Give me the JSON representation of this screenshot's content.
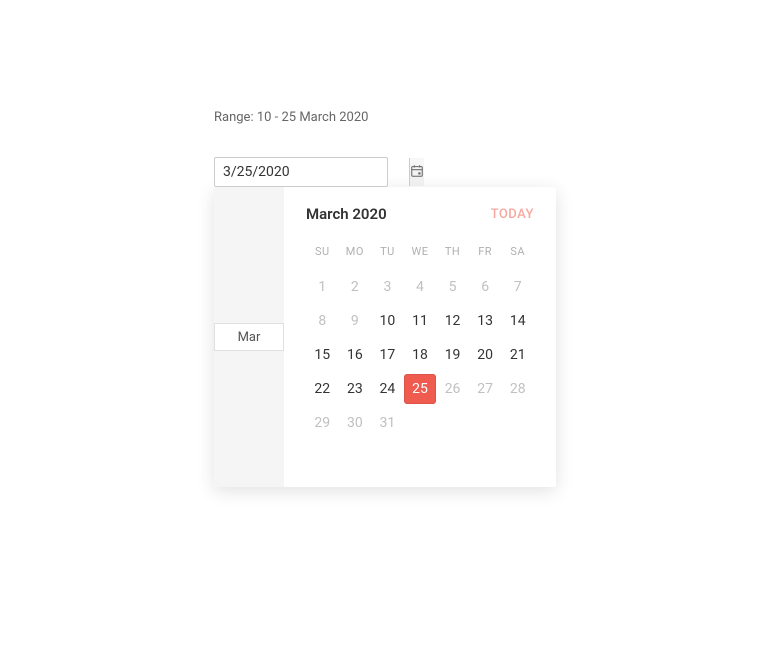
{
  "range_label": "Range: 10 - 25 March 2020",
  "input": {
    "value": "3/25/2020"
  },
  "sidebar": {
    "month_abbr": "Mar"
  },
  "calendar": {
    "title": "March 2020",
    "today_label": "TODAY",
    "dow": [
      "SU",
      "MO",
      "TU",
      "WE",
      "TH",
      "FR",
      "SA"
    ],
    "min_day": 10,
    "max_day": 25,
    "selected_day": 25,
    "days": [
      {
        "n": 1,
        "enabled": false
      },
      {
        "n": 2,
        "enabled": false
      },
      {
        "n": 3,
        "enabled": false
      },
      {
        "n": 4,
        "enabled": false
      },
      {
        "n": 5,
        "enabled": false
      },
      {
        "n": 6,
        "enabled": false
      },
      {
        "n": 7,
        "enabled": false
      },
      {
        "n": 8,
        "enabled": false
      },
      {
        "n": 9,
        "enabled": false
      },
      {
        "n": 10,
        "enabled": true
      },
      {
        "n": 11,
        "enabled": true
      },
      {
        "n": 12,
        "enabled": true
      },
      {
        "n": 13,
        "enabled": true
      },
      {
        "n": 14,
        "enabled": true
      },
      {
        "n": 15,
        "enabled": true
      },
      {
        "n": 16,
        "enabled": true
      },
      {
        "n": 17,
        "enabled": true
      },
      {
        "n": 18,
        "enabled": true
      },
      {
        "n": 19,
        "enabled": true
      },
      {
        "n": 20,
        "enabled": true
      },
      {
        "n": 21,
        "enabled": true
      },
      {
        "n": 22,
        "enabled": true
      },
      {
        "n": 23,
        "enabled": true
      },
      {
        "n": 24,
        "enabled": true
      },
      {
        "n": 25,
        "enabled": true,
        "selected": true
      },
      {
        "n": 26,
        "enabled": false
      },
      {
        "n": 27,
        "enabled": false
      },
      {
        "n": 28,
        "enabled": false
      },
      {
        "n": 29,
        "enabled": false
      },
      {
        "n": 30,
        "enabled": false
      },
      {
        "n": 31,
        "enabled": false
      }
    ]
  },
  "colors": {
    "accent": "#ef5b4f",
    "today_link": "#f7a8a0"
  }
}
